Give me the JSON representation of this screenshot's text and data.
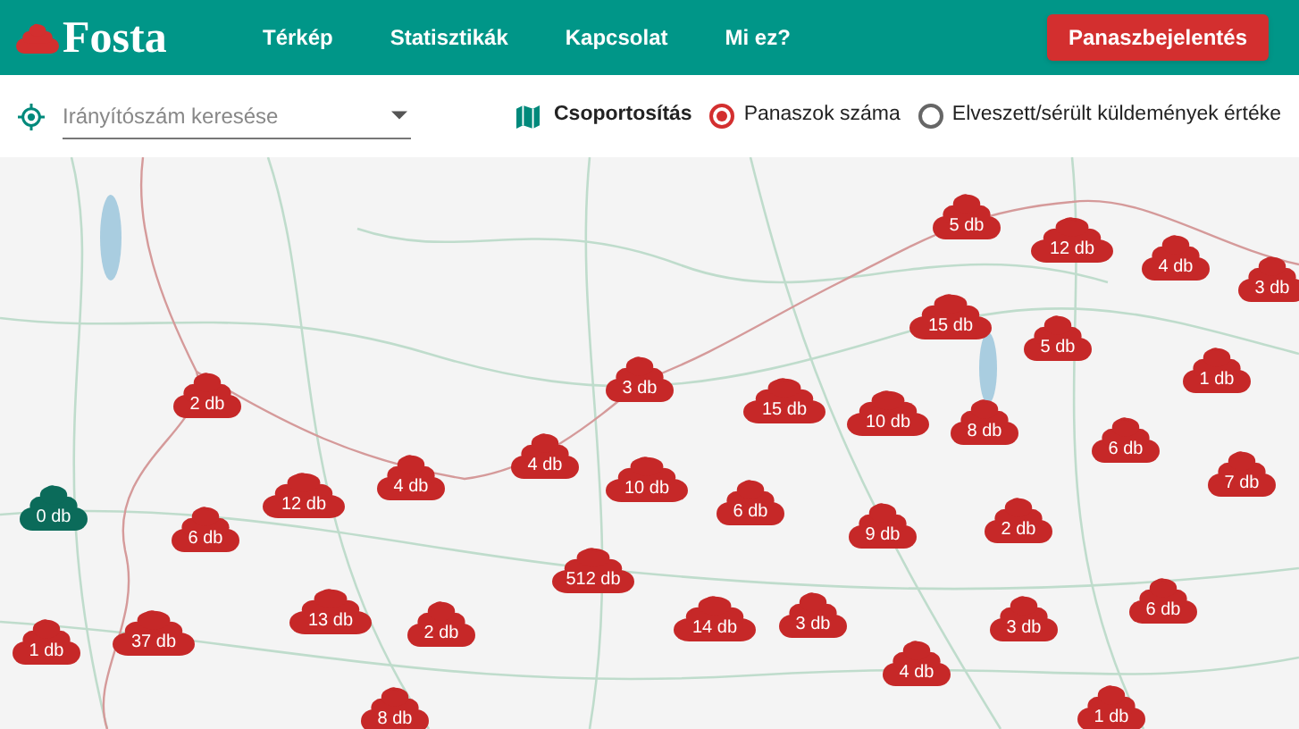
{
  "header": {
    "logo": "Fosta",
    "nav": [
      {
        "label": "Térkép"
      },
      {
        "label": "Statisztikák"
      },
      {
        "label": "Kapcsolat"
      },
      {
        "label": "Mi ez?"
      }
    ],
    "report_button": "Panaszbejelentés"
  },
  "toolbar": {
    "search": {
      "placeholder": "Irányítószám keresése"
    },
    "grouping_label": "Csoportosítás",
    "options": [
      {
        "label": "Panaszok száma",
        "selected": true
      },
      {
        "label": "Elveszett/sérült küldemények értéke",
        "selected": false
      }
    ]
  },
  "markers": [
    {
      "label": "5 db",
      "color": "#c62828"
    },
    {
      "label": "12 db",
      "color": "#c62828"
    },
    {
      "label": "4 db",
      "color": "#c62828"
    },
    {
      "label": "3 db",
      "color": "#c62828"
    },
    {
      "label": "2 db",
      "color": "#c62828"
    },
    {
      "label": "3 db",
      "color": "#c62828"
    },
    {
      "label": "15 db",
      "color": "#c62828"
    },
    {
      "label": "5 db",
      "color": "#c62828"
    },
    {
      "label": "1 db",
      "color": "#c62828"
    },
    {
      "label": "15 db",
      "color": "#c62828"
    },
    {
      "label": "10 db",
      "color": "#c62828"
    },
    {
      "label": "8 db",
      "color": "#c62828"
    },
    {
      "label": "6 db",
      "color": "#c62828"
    },
    {
      "label": "4 db",
      "color": "#c62828"
    },
    {
      "label": "10 db",
      "color": "#c62828"
    },
    {
      "label": "7 db",
      "color": "#c62828"
    },
    {
      "label": "0 db",
      "color": "#0b6b5a"
    },
    {
      "label": "12 db",
      "color": "#c62828"
    },
    {
      "label": "4 db",
      "color": "#c62828"
    },
    {
      "label": "6 db",
      "color": "#c62828"
    },
    {
      "label": "6 db",
      "color": "#c62828"
    },
    {
      "label": "9 db",
      "color": "#c62828"
    },
    {
      "label": "2 db",
      "color": "#c62828"
    },
    {
      "label": "512 db",
      "color": "#c62828"
    },
    {
      "label": "13 db",
      "color": "#c62828"
    },
    {
      "label": "2 db",
      "color": "#c62828"
    },
    {
      "label": "14 db",
      "color": "#c62828"
    },
    {
      "label": "3 db",
      "color": "#c62828"
    },
    {
      "label": "6 db",
      "color": "#c62828"
    },
    {
      "label": "3 db",
      "color": "#c62828"
    },
    {
      "label": "1 db",
      "color": "#c62828"
    },
    {
      "label": "37 db",
      "color": "#c62828"
    },
    {
      "label": "4 db",
      "color": "#c62828"
    },
    {
      "label": "1 db",
      "color": "#c62828"
    },
    {
      "label": "8 db",
      "color": "#c62828"
    }
  ]
}
